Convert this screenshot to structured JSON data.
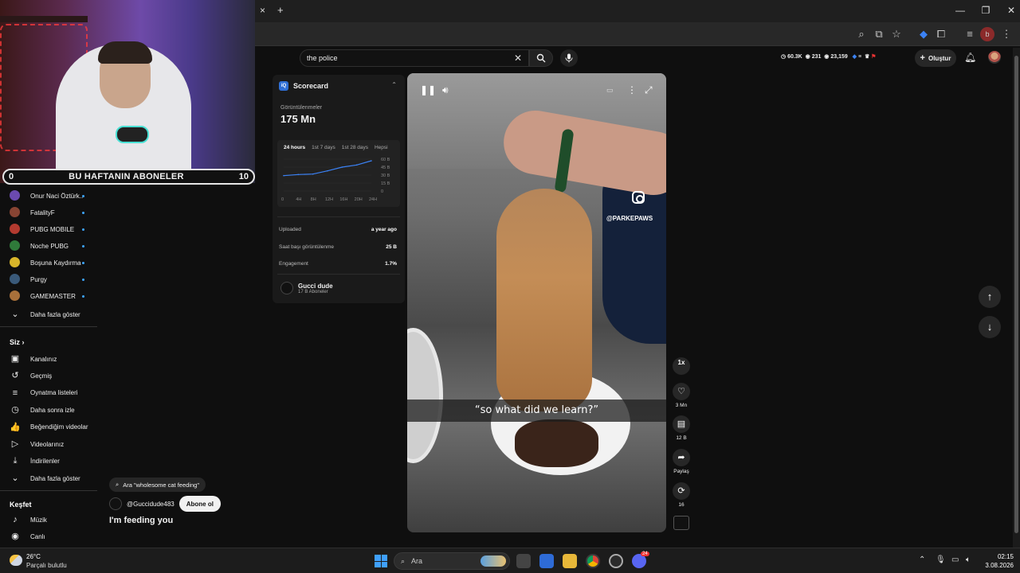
{
  "webcam": {
    "sub_left": "0",
    "sub_title": "BU HAFTANIN ABONELER",
    "sub_right": "10"
  },
  "browser": {
    "tab_close": "×",
    "new_tab": "+"
  },
  "sidebar": {
    "subscriptions": [
      {
        "label": "Onur Naci Öztürk...",
        "color": "#6b4ab0"
      },
      {
        "label": "FatalityF",
        "color": "#884433"
      },
      {
        "label": "PUBG MOBILE",
        "color": "#b33a2f"
      },
      {
        "label": "Noche PUBG",
        "color": "#2f7a3a"
      },
      {
        "label": "Boşuna Kaydırma",
        "color": "#d8b52a"
      },
      {
        "label": "Purgy",
        "color": "#3a5a7a"
      },
      {
        "label": "GAMEMASTER",
        "color": "#a8703a"
      }
    ],
    "show_more_1": "Daha fazla göster",
    "you_title": "Siz",
    "you_items": [
      {
        "label": "Kanalınız",
        "icon": "channel-icon",
        "glyph": "▣"
      },
      {
        "label": "Geçmiş",
        "icon": "history-icon",
        "glyph": "↺"
      },
      {
        "label": "Oynatma listeleri",
        "icon": "playlist-icon",
        "glyph": "≡"
      },
      {
        "label": "Daha sonra izle",
        "icon": "clock-icon",
        "glyph": "◷"
      },
      {
        "label": "Beğendiğim videolar",
        "icon": "thumbs-up-icon",
        "glyph": "👍"
      },
      {
        "label": "Videolarınız",
        "icon": "video-icon",
        "glyph": "▷"
      },
      {
        "label": "İndirilenler",
        "icon": "download-icon",
        "glyph": "⤓"
      }
    ],
    "show_more_2": "Daha fazla göster",
    "explore_title": "Keşfet",
    "explore_items": [
      {
        "label": "Müzik",
        "icon": "music-icon",
        "glyph": "♪"
      },
      {
        "label": "Canlı",
        "icon": "live-icon",
        "glyph": "◉"
      }
    ]
  },
  "search": {
    "value": "the police"
  },
  "stats": {
    "a": "60.3K",
    "b": "231",
    "c": "23,159"
  },
  "header": {
    "create_label": "Oluştur"
  },
  "scorecard": {
    "title": "Scorecard",
    "views_label": "Görüntülenmeler",
    "views_value": "175 Mn",
    "tabs": [
      "24 hours",
      "1st 7 days",
      "1st 28 days",
      "Hepsi"
    ],
    "chart_data": {
      "type": "line",
      "x": [
        "0",
        "4H",
        "8H",
        "12H",
        "16H",
        "20H",
        "24H"
      ],
      "y_ticks": [
        "60 B",
        "45 B",
        "30 B",
        "15 B",
        "0"
      ],
      "values": [
        29,
        31,
        32,
        38,
        45,
        49,
        57
      ],
      "ylim": [
        0,
        60
      ]
    },
    "rows": [
      {
        "label": "Uploaded",
        "value": "a year ago"
      },
      {
        "label": "Saat başı görüntülenme",
        "value": "25 B"
      },
      {
        "label": "Engagement",
        "value": "1.7%"
      }
    ],
    "channel_name": "Gucci dude",
    "channel_subs": "17 B Aboneler"
  },
  "video": {
    "caption": "“so what did we learn?”",
    "handle": "@PARKEPAWS"
  },
  "actions": {
    "speed": "1x",
    "likes": "3 Mn",
    "comments": "12 B",
    "share": "Paylaş",
    "remix": "16"
  },
  "overlay": {
    "suggestion": "Ara \"wholesome cat feeding\"",
    "channel": "@Guccidude483",
    "subscribe": "Abone ol",
    "title": "I'm feeding you"
  },
  "taskbar": {
    "temp": "26°C",
    "weather": "Parçalı bulutlu",
    "search_placeholder": "Ara",
    "time": "02:15",
    "date": "3.08.2026",
    "discord_badge": "24"
  }
}
